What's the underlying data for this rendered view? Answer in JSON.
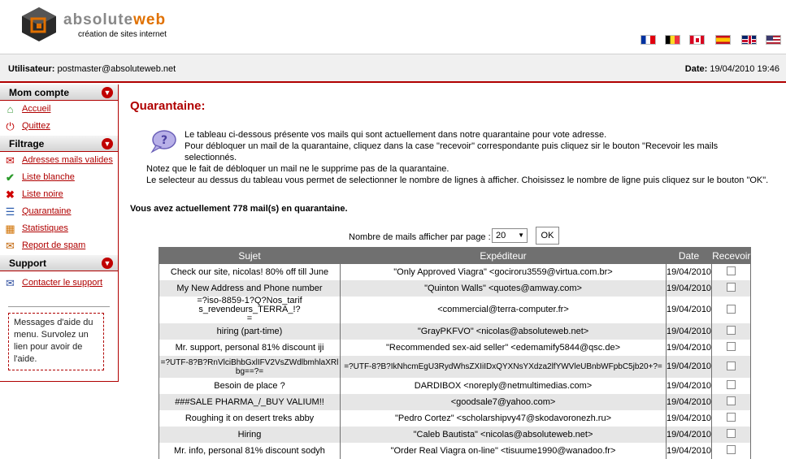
{
  "brand": {
    "name_a": "absolute",
    "name_b": "web",
    "tagline": "création de sites internet"
  },
  "flags": [
    "fr-flag-icon",
    "be-flag-icon",
    "ca-flag-icon",
    "es-flag-icon",
    "uk-flag-icon",
    "us-flag-icon"
  ],
  "userbar": {
    "user_label": "Utilisateur:",
    "user_value": "postmaster@absoluteweb.net",
    "date_label": "Date:",
    "date_value": "19/04/2010 19:46"
  },
  "sidebar": {
    "sections": [
      {
        "title": "Mom compte",
        "items": [
          "Accueil",
          "Quittez"
        ]
      },
      {
        "title": "Filtrage",
        "items": [
          "Adresses mails valides",
          "Liste blanche",
          "Liste noire",
          "Quarantaine",
          "Statistiques",
          "Report de spam"
        ]
      },
      {
        "title": "Support",
        "items": [
          "Contacter le support"
        ]
      }
    ],
    "help_text": "Messages d'aide du menu. Survolez un lien pour avoir de l'aide."
  },
  "main": {
    "title": "Quarantaine:",
    "intro_1": "Le tableau ci-dessous présente vos mails qui sont actuellement dans notre quarantaine pour vote adresse.",
    "intro_2": "Pour débloquer un mail de la quarantaine, cliquez dans la case \"recevoir\" correspondante puis cliquez sir le bouton \"Recevoir les mails",
    "intro_3": "selectionnés.",
    "intro_4": "Notez que le fait de débloquer un mail ne le supprime pas de la quarantaine.",
    "intro_5": "Le selecteur au dessus du tableau vous permet de selectionner le nombre de lignes à afficher. Choisissez le nombre de ligne puis cliquez sur le bouton \"OK\".",
    "count_text": "Vous avez actuellement 778 mail(s) en quarantaine.",
    "perpage_label": "Nombre de mails afficher par page :",
    "perpage_value": "20",
    "ok_label": "OK"
  },
  "table": {
    "headers": [
      "Sujet",
      "Expéditeur",
      "Date",
      "Recevoir"
    ],
    "rows": [
      {
        "subject": "Check our site, nicolas! 80% off till June",
        "sender": "\"Only Approved Viagra\" <gociroru3559@virtua.com.br>",
        "date": "19/04/2010"
      },
      {
        "subject": "My New Address and Phone number",
        "sender": "\"Quinton Walls\" <quotes@amway.com>",
        "date": "19/04/2010"
      },
      {
        "subject": "=?iso-8859-1?Q?Nos_tarifs_revendeurs_TERRA_!?=",
        "sender": "<commercial@terra-computer.fr>",
        "date": "19/04/2010"
      },
      {
        "subject": "hiring (part-time)",
        "sender": "\"GrayPKFVO\" <nicolas@absoluteweb.net>",
        "date": "19/04/2010"
      },
      {
        "subject": "Mr. support, personal 81% discount iji",
        "sender": "\"Recommended sex-aid seller\" <edemamify5844@qsc.de>",
        "date": "19/04/2010"
      },
      {
        "subject": "=?UTF-8?B?RnVlciBhbGxlIFV2VsZWdlbmhlaXRlbg==?=",
        "sender": "=?UTF-8?B?IkNhcmEgU3RydWhsZXIiIDxQYXNsYXdza2lfYWVleUBnbWFpbC5jb20+?=",
        "date": "19/04/2010"
      },
      {
        "subject": "Besoin de place ?",
        "sender": "DARDIBOX <noreply@netmultimedias.com>",
        "date": "19/04/2010"
      },
      {
        "subject": "###SALE PHARMA_/_BUY VALIUM!!",
        "sender": "<goodsale7@yahoo.com>",
        "date": "19/04/2010"
      },
      {
        "subject": "Roughing it on desert treks abby",
        "sender": "\"Pedro Cortez\" <scholarshipvy47@skodavoronezh.ru>",
        "date": "19/04/2010"
      },
      {
        "subject": "Hiring",
        "sender": "\"Caleb Bautista\" <nicolas@absoluteweb.net>",
        "date": "19/04/2010"
      },
      {
        "subject": "Mr. info, personal 81% discount sodyh",
        "sender": "\"Order Real Viagra on-line\" <tisuume1990@wanadoo.fr>",
        "date": "19/04/2010"
      }
    ]
  }
}
